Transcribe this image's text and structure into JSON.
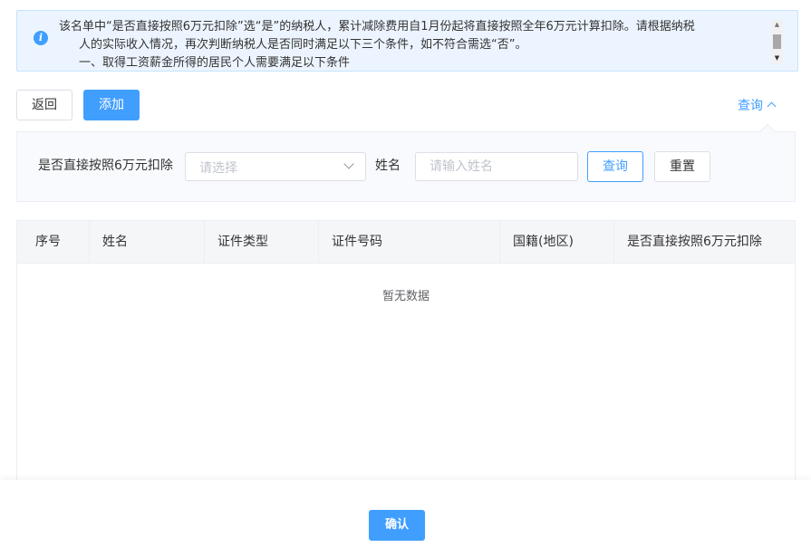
{
  "notice": {
    "line1": "该名单中“是否直接按照6万元扣除”选“是”的纳税人，累计减除费用自1月份起将直接按照全年6万元计算扣除。请根据纳税",
    "line2": "人的实际收入情况，再次判断纳税人是否同时满足以下三个条件，如不符合需选“否”。",
    "line3": "一、取得工资薪金所得的居民个人需要满足以下条件"
  },
  "toolbar": {
    "back_label": "返回",
    "add_label": "添加",
    "toggle_label": "查询"
  },
  "search": {
    "deduction_label": "是否直接按照6万元扣除",
    "deduction_placeholder": "请选择",
    "name_label": "姓名",
    "name_placeholder": "请输入姓名",
    "query_label": "查询",
    "reset_label": "重置"
  },
  "table": {
    "columns": [
      "序号",
      "姓名",
      "证件类型",
      "证件号码",
      "国籍(地区)",
      "是否直接按照6万元扣除"
    ],
    "empty_text": "暂无数据"
  },
  "footer": {
    "confirm_label": "确认"
  },
  "colors": {
    "primary": "#409eff",
    "notice_bg": "#ecf5ff"
  }
}
